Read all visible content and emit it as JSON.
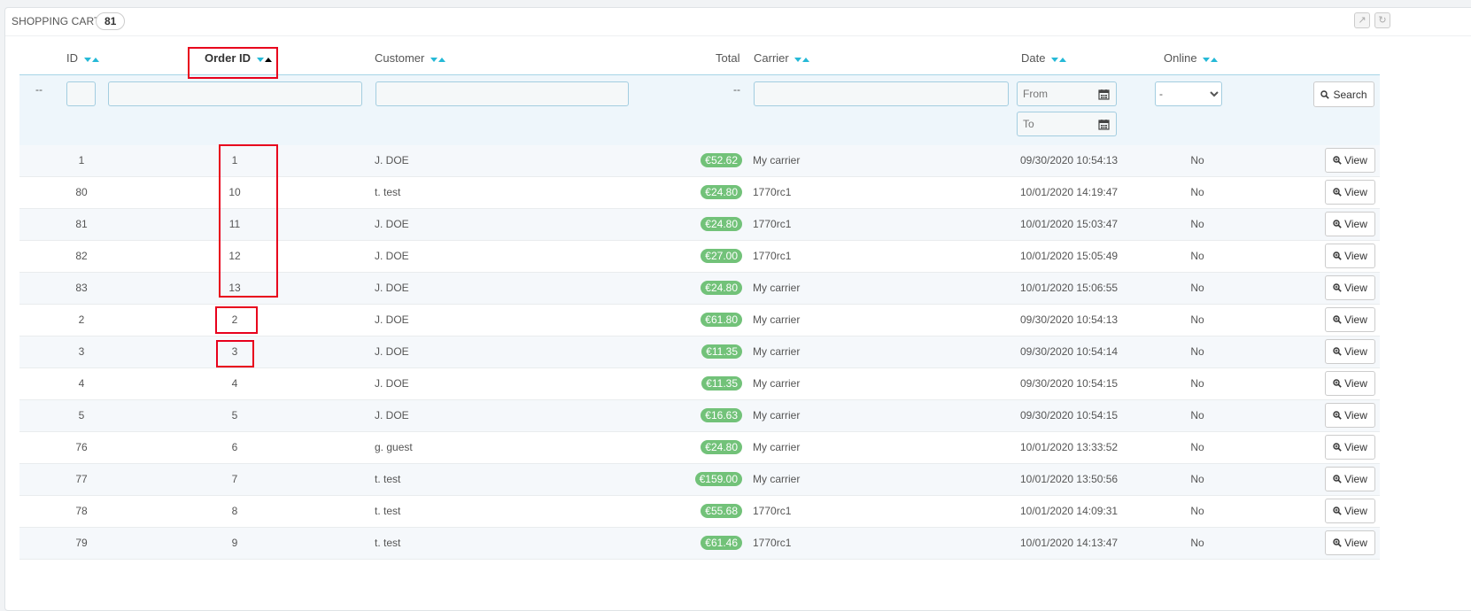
{
  "panel": {
    "title": "Shopping Carts",
    "count": "81"
  },
  "columns": {
    "id": "ID",
    "order_id": "Order ID",
    "customer": "Customer",
    "total": "Total",
    "carrier": "Carrier",
    "date": "Date",
    "online": "Online"
  },
  "filters": {
    "id_dash": "--",
    "total_dash": "--",
    "date_from_placeholder": "From",
    "date_to_placeholder": "To",
    "online_selected": "-",
    "search_label": "Search"
  },
  "view_label": "View",
  "colors": {
    "total_badge": "#72c279",
    "accent": "#25b9d7",
    "highlight": "#e8001c"
  },
  "rows": [
    {
      "id": "1",
      "order_id": "1",
      "customer": "J. DOE",
      "total": "€52.62",
      "carrier": "My carrier",
      "date": "09/30/2020 10:54:13",
      "online": "No"
    },
    {
      "id": "80",
      "order_id": "10",
      "customer": "t. test",
      "total": "€24.80",
      "carrier": "1770rc1",
      "date": "10/01/2020 14:19:47",
      "online": "No"
    },
    {
      "id": "81",
      "order_id": "11",
      "customer": "J. DOE",
      "total": "€24.80",
      "carrier": "1770rc1",
      "date": "10/01/2020 15:03:47",
      "online": "No"
    },
    {
      "id": "82",
      "order_id": "12",
      "customer": "J. DOE",
      "total": "€27.00",
      "carrier": "1770rc1",
      "date": "10/01/2020 15:05:49",
      "online": "No"
    },
    {
      "id": "83",
      "order_id": "13",
      "customer": "J. DOE",
      "total": "€24.80",
      "carrier": "My carrier",
      "date": "10/01/2020 15:06:55",
      "online": "No"
    },
    {
      "id": "2",
      "order_id": "2",
      "customer": "J. DOE",
      "total": "€61.80",
      "carrier": "My carrier",
      "date": "09/30/2020 10:54:13",
      "online": "No"
    },
    {
      "id": "3",
      "order_id": "3",
      "customer": "J. DOE",
      "total": "€11.35",
      "carrier": "My carrier",
      "date": "09/30/2020 10:54:14",
      "online": "No"
    },
    {
      "id": "4",
      "order_id": "4",
      "customer": "J. DOE",
      "total": "€11.35",
      "carrier": "My carrier",
      "date": "09/30/2020 10:54:15",
      "online": "No"
    },
    {
      "id": "5",
      "order_id": "5",
      "customer": "J. DOE",
      "total": "€16.63",
      "carrier": "My carrier",
      "date": "09/30/2020 10:54:15",
      "online": "No"
    },
    {
      "id": "76",
      "order_id": "6",
      "customer": "g. guest",
      "total": "€24.80",
      "carrier": "My carrier",
      "date": "10/01/2020 13:33:52",
      "online": "No"
    },
    {
      "id": "77",
      "order_id": "7",
      "customer": "t. test",
      "total": "€159.00",
      "carrier": "My carrier",
      "date": "10/01/2020 13:50:56",
      "online": "No"
    },
    {
      "id": "78",
      "order_id": "8",
      "customer": "t. test",
      "total": "€55.68",
      "carrier": "1770rc1",
      "date": "10/01/2020 14:09:31",
      "online": "No"
    },
    {
      "id": "79",
      "order_id": "9",
      "customer": "t. test",
      "total": "€61.46",
      "carrier": "1770rc1",
      "date": "10/01/2020 14:13:47",
      "online": "No"
    }
  ]
}
